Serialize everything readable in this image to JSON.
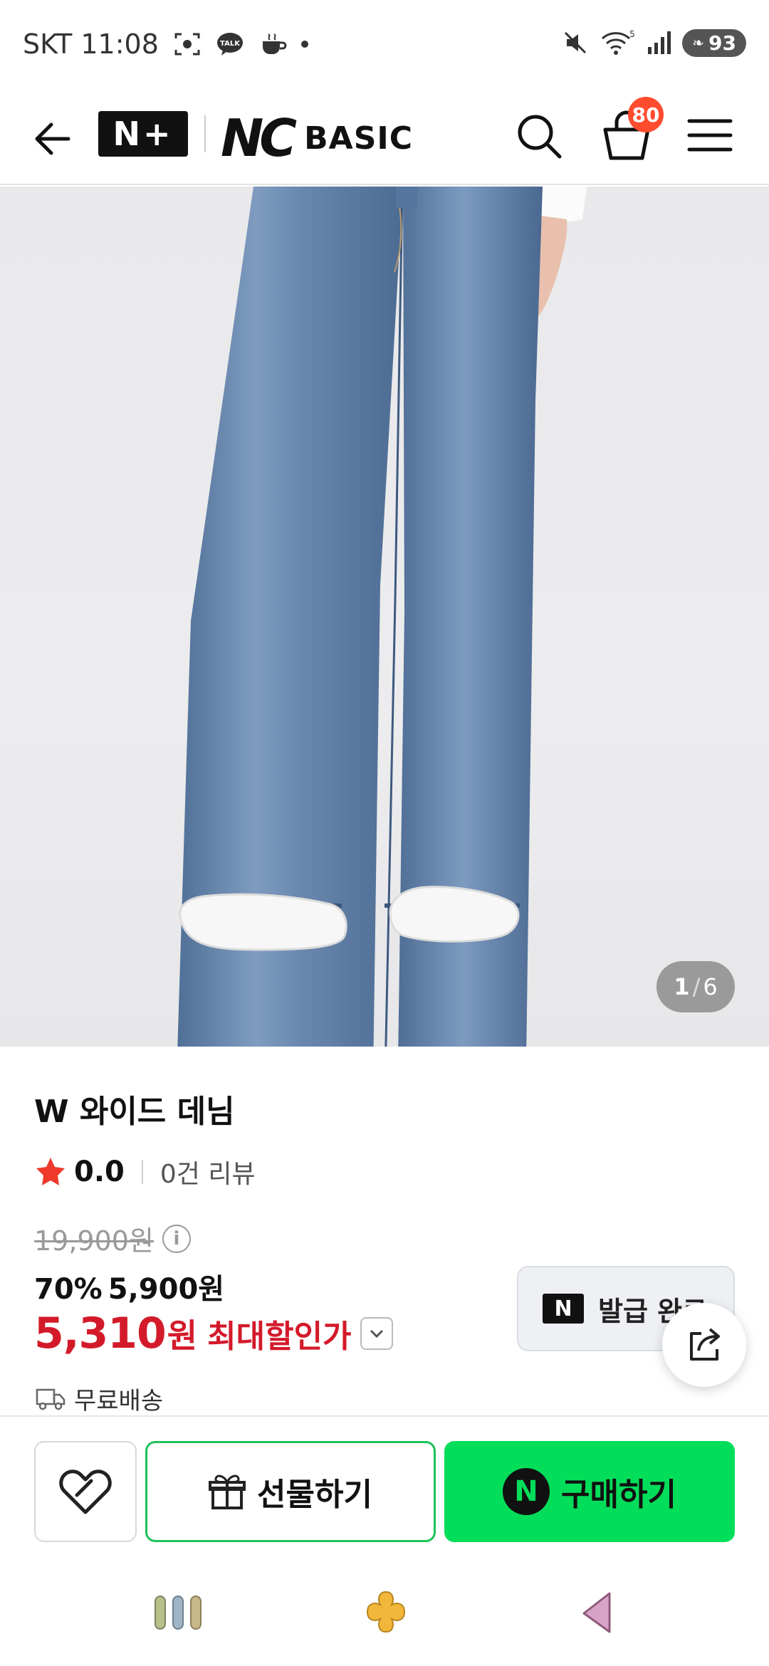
{
  "status_bar": {
    "carrier_time": "SKT 11:08",
    "battery": "93",
    "wifi_label": "5"
  },
  "header": {
    "np_logo": "N+",
    "brand_nc": "NC",
    "brand_basic": "BASIC",
    "cart_count": "80"
  },
  "gallery": {
    "current": "1",
    "separator": "/",
    "total": "6"
  },
  "product": {
    "name": "W 와이드 데님",
    "rating": "0.0",
    "review_text": "0건 리뷰",
    "original_price": "19,900원",
    "discount_rate": "70%",
    "sale_price": "5,900원",
    "max_price": "5,310",
    "max_won": "원",
    "max_label": "최대할인가",
    "shipping": "무료배송"
  },
  "coupon": {
    "logo": "N",
    "label": "발급 완료"
  },
  "actions": {
    "gift_label": "선물하기",
    "buy_label": "구매하기",
    "naver_n": "N"
  },
  "colors": {
    "accent_green": "#03de5a",
    "price_red": "#d31a2a",
    "badge_orange": "#ff4b2e",
    "star_red": "#ee3b2c"
  }
}
